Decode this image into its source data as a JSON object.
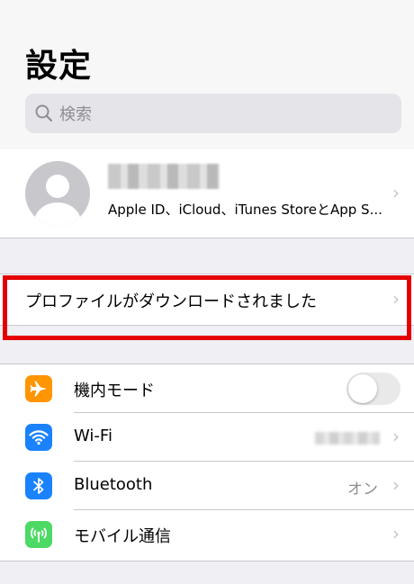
{
  "header": {
    "title": "設定",
    "search_placeholder": "検索"
  },
  "profile": {
    "subtitle": "Apple ID、iCloud、iTunes StoreとApp S..."
  },
  "notice": {
    "label": "プロファイルがダウンロードされました"
  },
  "settings": [
    {
      "label": "機内モード",
      "icon": "airplane-icon",
      "color": "#ff9500",
      "toggle_on": false
    },
    {
      "label": "Wi-Fi",
      "icon": "wifi-icon",
      "color": "#1a82fb"
    },
    {
      "label": "Bluetooth",
      "icon": "bluetooth-icon",
      "color": "#1a82fb",
      "value": "オン"
    },
    {
      "label": "モバイル通信",
      "icon": "cellular-icon",
      "color": "#4cd964"
    }
  ],
  "highlight_color": "#e40000"
}
